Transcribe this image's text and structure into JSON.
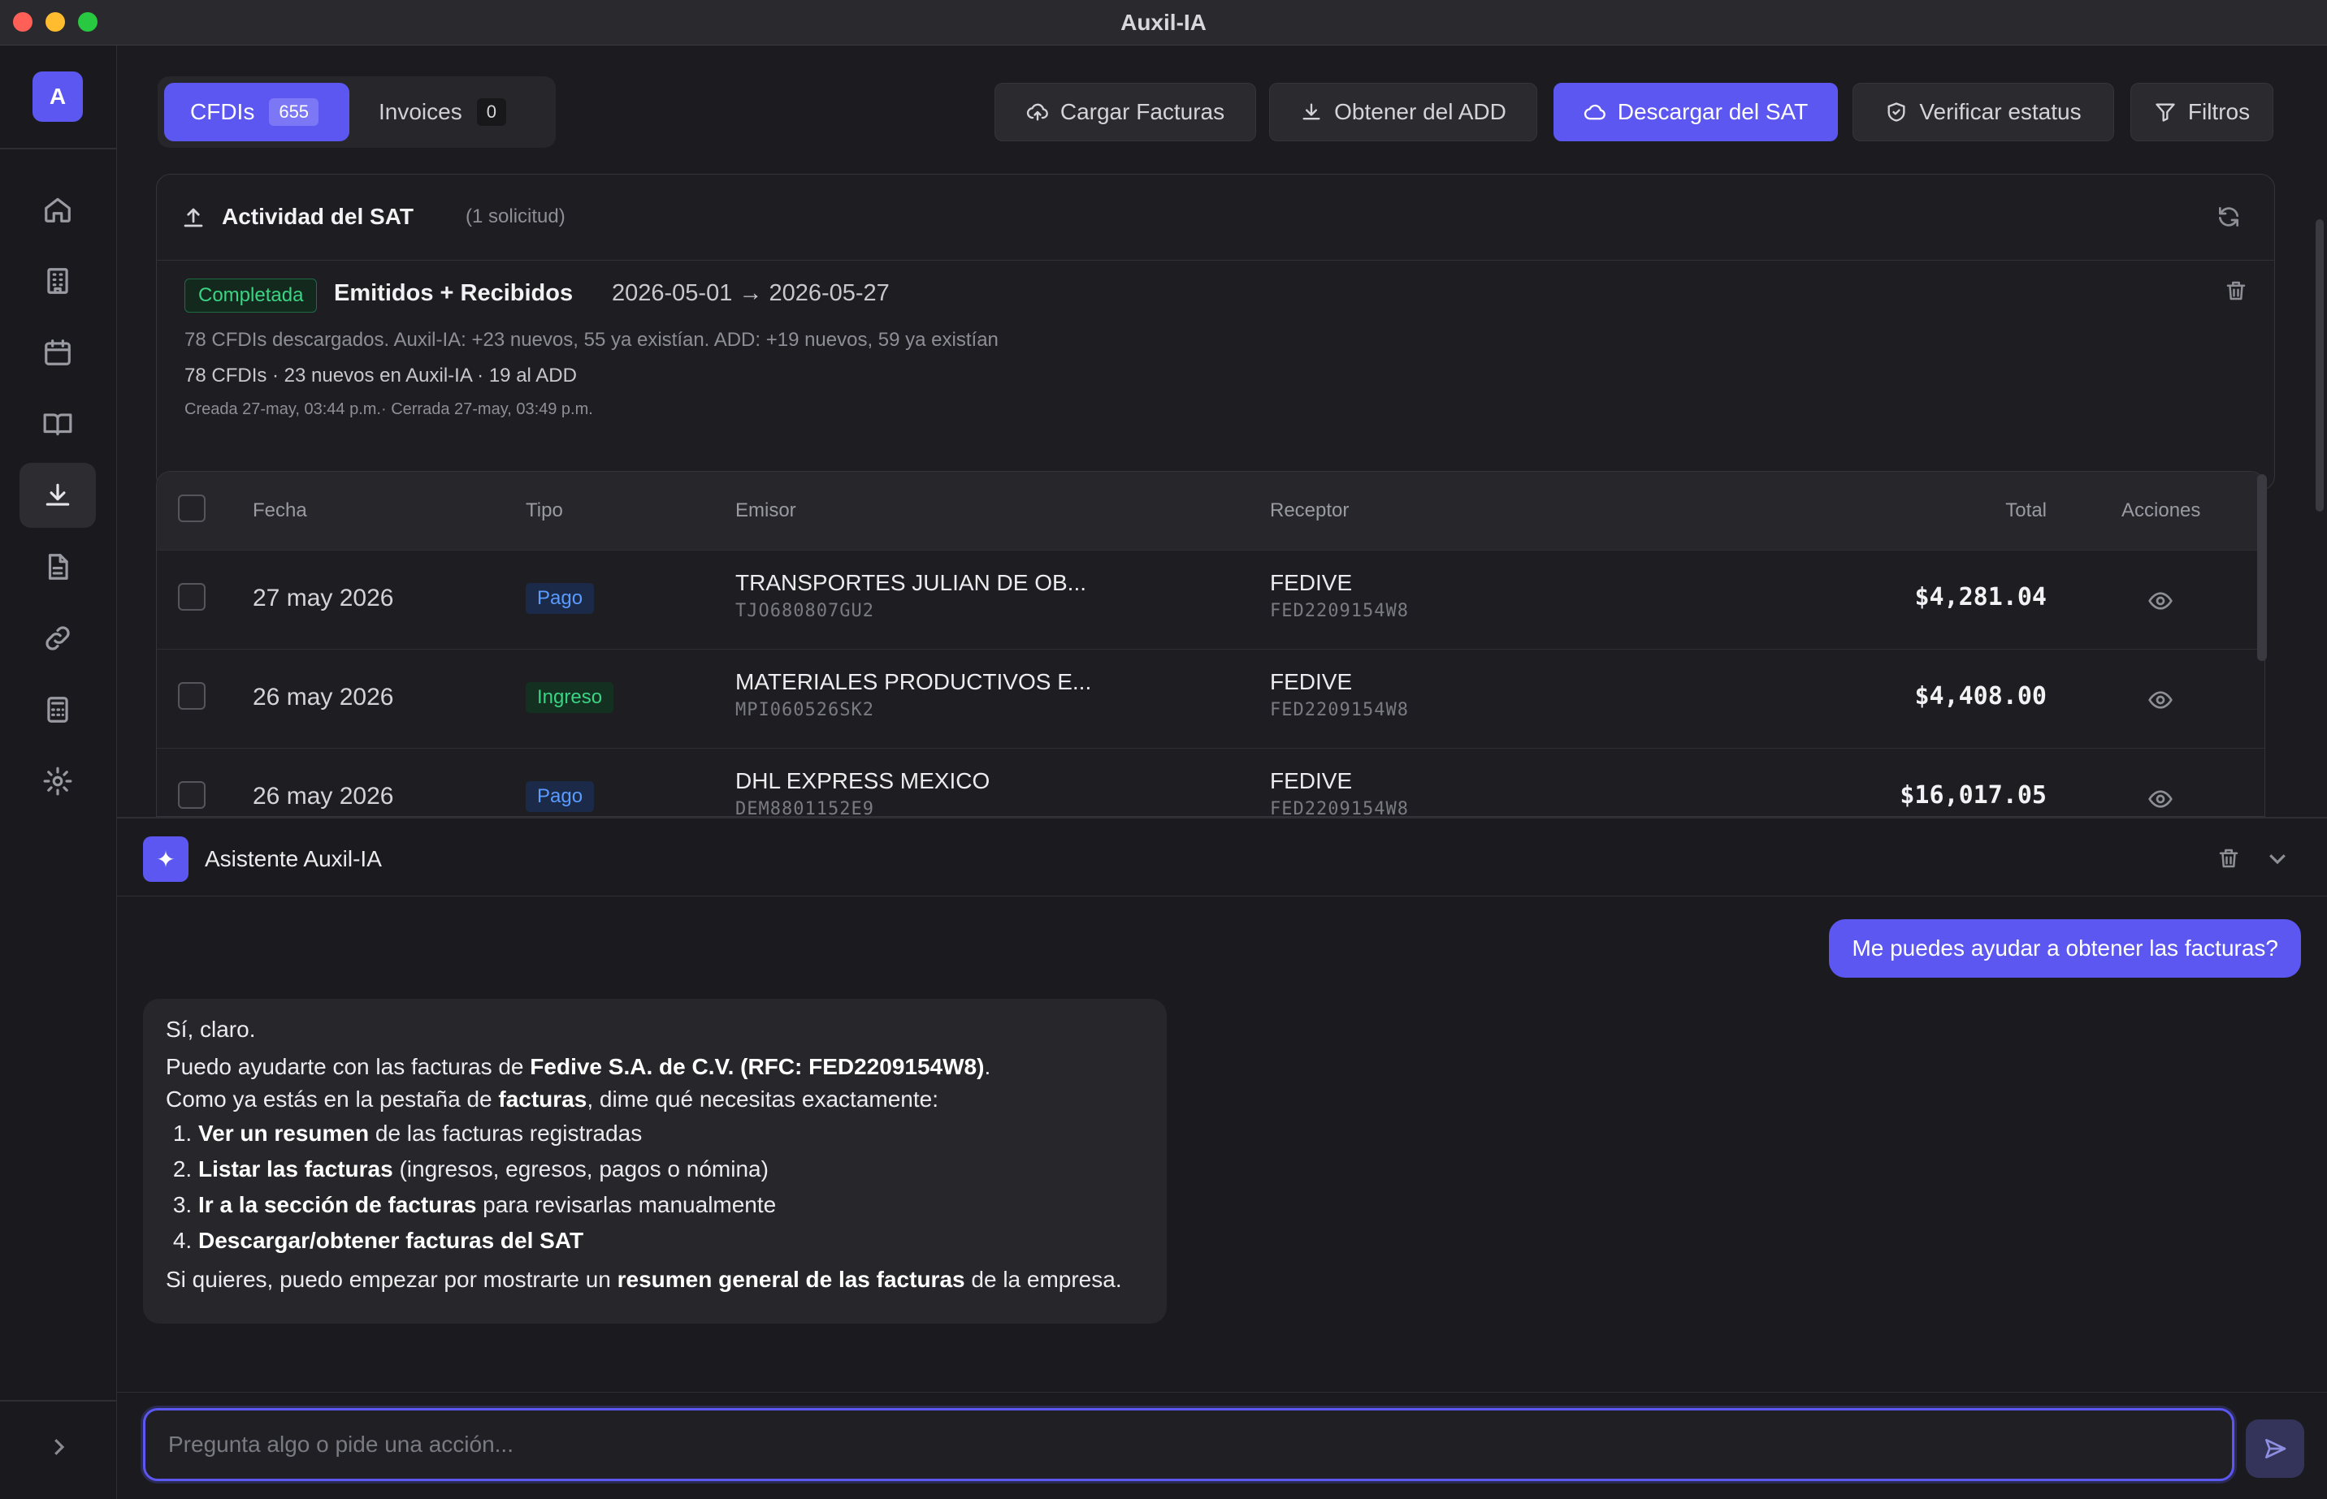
{
  "window": {
    "title": "Auxil-IA"
  },
  "sidebar": {
    "avatar_letter": "A",
    "items": [
      {
        "icon": "home-icon"
      },
      {
        "icon": "building-icon"
      },
      {
        "icon": "calendar-icon"
      },
      {
        "icon": "book-icon"
      },
      {
        "icon": "download-icon",
        "active": true
      },
      {
        "icon": "document-icon"
      },
      {
        "icon": "link-icon"
      },
      {
        "icon": "calculator-icon"
      },
      {
        "icon": "gear-icon"
      }
    ]
  },
  "tabs": [
    {
      "label": "CFDIs",
      "count": "655",
      "active": true
    },
    {
      "label": "Invoices",
      "count": "0",
      "active": false
    }
  ],
  "toolbar": {
    "cargar": "Cargar Facturas",
    "obtener": "Obtener del ADD",
    "descargar": "Descargar del SAT",
    "verificar": "Verificar estatus",
    "filtros": "Filtros"
  },
  "activity": {
    "title": "Actividad del SAT",
    "subtitle": "(1 solicitud)",
    "request": {
      "status": "Completada",
      "title": "Emitidos + Recibidos",
      "range": "2026-05-01 → 2026-05-27",
      "line1": "78 CFDIs descargados. Auxil-IA: +23 nuevos, 55 ya existían. ADD: +19 nuevos, 59 ya existían",
      "line2": "78 CFDIs · 23 nuevos en Auxil-IA · 19 al ADD",
      "line3": "Creada 27-may, 03:44 p.m.· Cerrada 27-may, 03:49 p.m."
    }
  },
  "table": {
    "headers": {
      "fecha": "Fecha",
      "tipo": "Tipo",
      "emisor": "Emisor",
      "receptor": "Receptor",
      "total": "Total",
      "acciones": "Acciones"
    },
    "rows": [
      {
        "fecha": "27 may 2026",
        "tipo": "Pago",
        "emisor": "TRANSPORTES JULIAN DE OB...",
        "emisor_rfc": "TJO680807GU2",
        "receptor": "FEDIVE",
        "receptor_rfc": "FED2209154W8",
        "total": "$4,281.04"
      },
      {
        "fecha": "26 may 2026",
        "tipo": "Ingreso",
        "emisor": "MATERIALES PRODUCTIVOS E...",
        "emisor_rfc": "MPI060526SK2",
        "receptor": "FEDIVE",
        "receptor_rfc": "FED2209154W8",
        "total": "$4,408.00"
      },
      {
        "fecha": "26 may 2026",
        "tipo": "Pago",
        "emisor": "DHL EXPRESS MEXICO",
        "emisor_rfc": "DEM8801152E9",
        "receptor": "FEDIVE",
        "receptor_rfc": "FED2209154W8",
        "total": "$16,017.05"
      }
    ]
  },
  "assistant": {
    "title": "Asistente Auxil-IA",
    "user_message": "Me puedes ayudar a obtener las facturas?",
    "bot": {
      "l1": "Sí, claro.",
      "l2a": "Puedo ayudarte con las facturas de ",
      "l2b": "Fedive S.A. de C.V. (RFC: FED2209154W8)",
      "l2c": ".",
      "l3a": "Como ya estás en la pestaña de ",
      "l3b": "facturas",
      "l3c": ", dime qué necesitas exactamente:",
      "items": [
        {
          "b": "Ver un resumen",
          "t": " de las facturas registradas"
        },
        {
          "b": "Listar las facturas",
          "t": " (ingresos, egresos, pagos o nómina)"
        },
        {
          "b": "Ir a la sección de facturas",
          "t": " para revisarlas manualmente"
        },
        {
          "b": "Descargar/obtener facturas del SAT",
          "t": ""
        }
      ],
      "l4a": "Si quieres, puedo empezar por mostrarte un ",
      "l4b": "resumen general de las facturas",
      "l4c": " de la empresa."
    },
    "input_placeholder": "Pregunta algo o pide una acción..."
  }
}
